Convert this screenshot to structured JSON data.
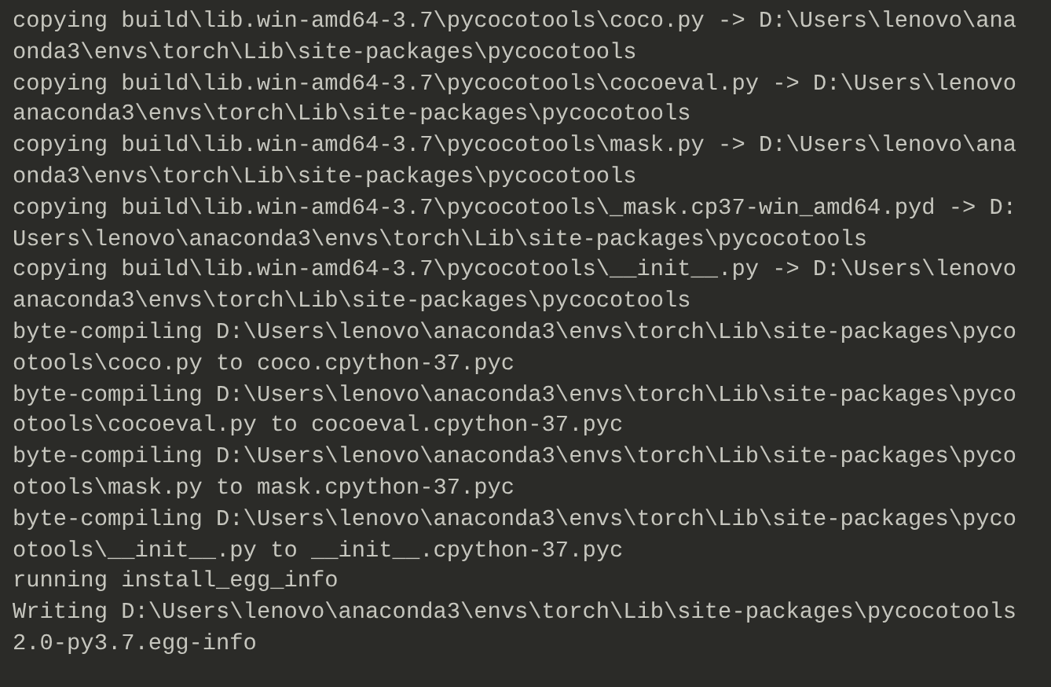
{
  "terminal": {
    "lines": [
      "copying build\\lib.win-amd64-3.7\\pycocotools\\coco.py -> D:\\Users\\lenovo\\ana",
      "onda3\\envs\\torch\\Lib\\site-packages\\pycocotools",
      "copying build\\lib.win-amd64-3.7\\pycocotools\\cocoeval.py -> D:\\Users\\lenovo",
      "anaconda3\\envs\\torch\\Lib\\site-packages\\pycocotools",
      "copying build\\lib.win-amd64-3.7\\pycocotools\\mask.py -> D:\\Users\\lenovo\\ana",
      "onda3\\envs\\torch\\Lib\\site-packages\\pycocotools",
      "copying build\\lib.win-amd64-3.7\\pycocotools\\_mask.cp37-win_amd64.pyd -> D:",
      "Users\\lenovo\\anaconda3\\envs\\torch\\Lib\\site-packages\\pycocotools",
      "copying build\\lib.win-amd64-3.7\\pycocotools\\__init__.py -> D:\\Users\\lenovo",
      "anaconda3\\envs\\torch\\Lib\\site-packages\\pycocotools",
      "byte-compiling D:\\Users\\lenovo\\anaconda3\\envs\\torch\\Lib\\site-packages\\pyco",
      "otools\\coco.py to coco.cpython-37.pyc",
      "byte-compiling D:\\Users\\lenovo\\anaconda3\\envs\\torch\\Lib\\site-packages\\pyco",
      "otools\\cocoeval.py to cocoeval.cpython-37.pyc",
      "byte-compiling D:\\Users\\lenovo\\anaconda3\\envs\\torch\\Lib\\site-packages\\pyco",
      "otools\\mask.py to mask.cpython-37.pyc",
      "byte-compiling D:\\Users\\lenovo\\anaconda3\\envs\\torch\\Lib\\site-packages\\pyco",
      "otools\\__init__.py to __init__.cpython-37.pyc",
      "running install_egg_info",
      "Writing D:\\Users\\lenovo\\anaconda3\\envs\\torch\\Lib\\site-packages\\pycocotools",
      "2.0-py3.7.egg-info"
    ]
  }
}
